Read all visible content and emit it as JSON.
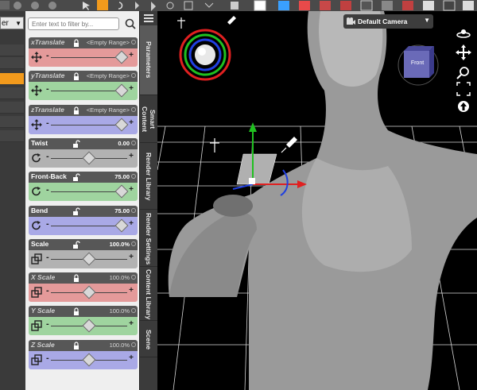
{
  "filter": {
    "placeholder": "Enter text to filter by..."
  },
  "left_panel": {
    "dropdown_label": "er"
  },
  "sliders": [
    {
      "label": "xTranslate",
      "value": "<Empty Range>",
      "color": "red",
      "locked": true,
      "icon": "move-icon",
      "knob_pos": 0.93
    },
    {
      "label": "yTranslate",
      "value": "<Empty Range>",
      "color": "green",
      "locked": true,
      "icon": "move-icon",
      "knob_pos": 0.93
    },
    {
      "label": "zTranslate",
      "value": "<Empty Range>",
      "color": "blue",
      "locked": true,
      "icon": "move-icon",
      "knob_pos": 0.93
    },
    {
      "label": "Twist",
      "value": "0.00",
      "color": "gray",
      "locked": false,
      "icon": "rotate-icon",
      "knob_pos": 0.5
    },
    {
      "label": "Front-Back",
      "value": "75.00",
      "color": "green",
      "locked": false,
      "icon": "rotate-icon",
      "knob_pos": 0.93
    },
    {
      "label": "Bend",
      "value": "75.00",
      "color": "blue",
      "locked": false,
      "icon": "rotate-icon",
      "knob_pos": 0.93
    },
    {
      "label": "Scale",
      "value": "100.0%",
      "color": "gray",
      "locked": false,
      "icon": "scale-icon",
      "knob_pos": 0.5
    },
    {
      "label": "X Scale",
      "value": "100.0%",
      "color": "red",
      "locked": true,
      "icon": "scale-icon",
      "knob_pos": 0.5
    },
    {
      "label": "Y Scale",
      "value": "100.0%",
      "color": "green",
      "locked": true,
      "icon": "scale-icon",
      "knob_pos": 0.5
    },
    {
      "label": "Z Scale",
      "value": "100.0%",
      "color": "blue",
      "locked": true,
      "icon": "scale-icon",
      "knob_pos": 0.5
    }
  ],
  "tabs": [
    {
      "label": "Parameters",
      "active": true
    },
    {
      "label": "Smart Content",
      "active": false
    },
    {
      "label": "Render Library",
      "active": false
    },
    {
      "label": "Render Settings",
      "active": false
    },
    {
      "label": "Content Library",
      "active": false
    },
    {
      "label": "Scene",
      "active": false
    }
  ],
  "viewport": {
    "camera_label": "Default Camera",
    "view_cube_label": "Front"
  },
  "colors": {
    "slider_red": "#e49a9a",
    "slider_green": "#9fd49f",
    "slider_blue": "#a9a9e6",
    "slider_gray": "#b2b2b2",
    "active_orange": "#f29a1c",
    "gizmo_x": "#e02020",
    "gizmo_y": "#20c020",
    "gizmo_z": "#2040e0"
  }
}
